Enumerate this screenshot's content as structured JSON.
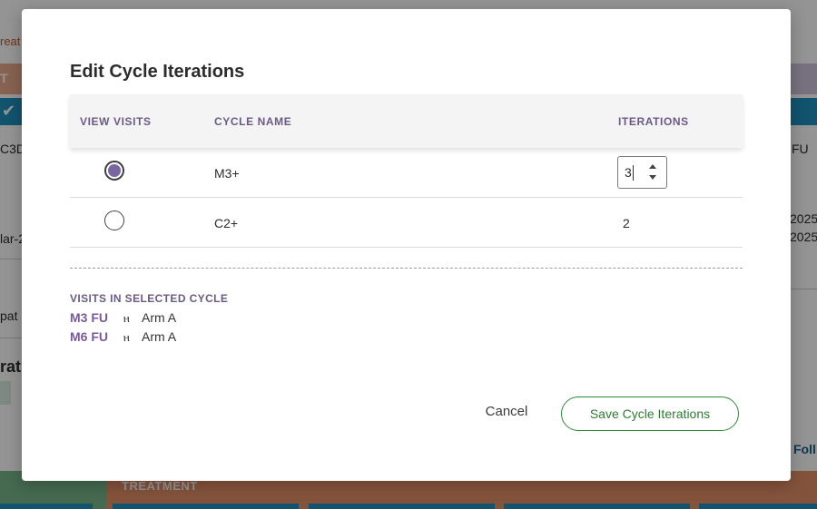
{
  "background": {
    "fragments": {
      "top_left_text": "reat",
      "header_char": "T",
      "left_code": "C3D",
      "right_code": "FU",
      "left_date": "lar-2",
      "right_date_1": "2025",
      "right_date_2": "2025",
      "left_pat": "pat",
      "left_rat": "rat",
      "right_foll": "Foll",
      "bottom_label": "TREATMENT"
    }
  },
  "modal": {
    "title": "Edit Cycle Iterations",
    "columns": {
      "view_visits": "VIEW VISITS",
      "cycle_name": "CYCLE NAME",
      "iterations": "ITERATIONS"
    },
    "rows": [
      {
        "cycle_name": "M3+",
        "iterations": "3",
        "selected": true
      },
      {
        "cycle_name": "C2+",
        "iterations": "2",
        "selected": false
      }
    ],
    "visits_title": "VISITS IN SELECTED CYCLE",
    "visits": [
      {
        "name": "M3 FU",
        "arm": "Arm A",
        "icon": "branch-icon"
      },
      {
        "name": "M6 FU",
        "arm": "Arm A",
        "icon": "branch-icon"
      }
    ],
    "cancel_label": "Cancel",
    "save_label": "Save Cycle Iterations"
  },
  "colors": {
    "accent_purple": "#6a5a86",
    "save_green": "#2e7d32",
    "radio_fill": "#7a66a0"
  }
}
